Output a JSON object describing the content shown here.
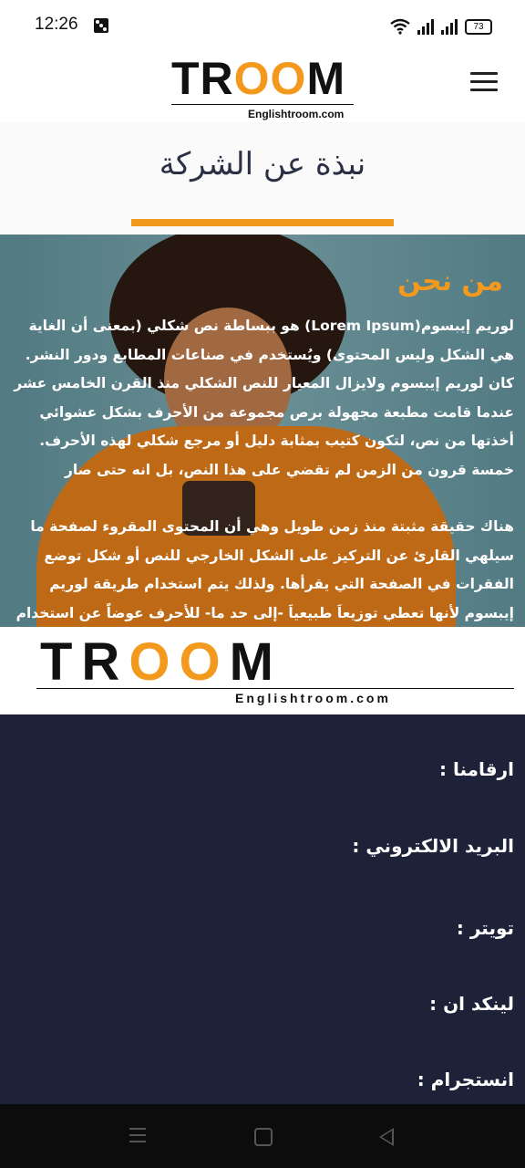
{
  "status_bar": {
    "time": "12:26",
    "battery": "73"
  },
  "header": {
    "logo_text_left": "TR",
    "logo_text_oo": "OO",
    "logo_text_right": "M",
    "logo_subtitle": "Englishtroom.com",
    "menu_icon": "hamburger-icon"
  },
  "page": {
    "title": "نبذة عن الشركة"
  },
  "hero": {
    "heading": "من نحن",
    "paragraph1": "لوريم إيبسوم(Lorem Ipsum) هو ببساطة نص شكلي (بمعنى أن الغاية هي الشكل وليس المحتوى) ويُستخدم في صناعات المطابع ودور النشر. كان لوريم إيبسوم ولايزال المعيار للنص الشكلي منذ القرن الخامس عشر عندما قامت مطبعة مجهولة برص مجموعة من الأحرف بشكل عشوائي أخذتها من نص، لتكون كتيب بمثابة دليل أو مرجع شكلي لهذه الأحرف. خمسة قرون من الزمن لم تقضي على هذا النص، بل انه حتى صار مستخدماً وبشكله الأصلي في الطباعة والتنضيد الالكتروني. انتشر بشكل",
    "paragraph2": "هناك حقيقة مثبتة منذ زمن طويل وهي أن المحتوى المقروء لصفحة ما سيلهي القارئ عن التركيز على الشكل الخارجي للنص أو شكل توضع الفقرات في الصفحة التي يقرأها. ولذلك يتم استخدام طريقة لوريم إيبسوم لأنها تعطي توزيعاَ طبيعياَ -إلى حد ما- للأحرف عوضاً عن استخدام \"هنا يوجد محتوى نص، هنا يوجد محتوى نص\""
  },
  "footer_logo": {
    "text_left": "TR",
    "text_oo": "OO",
    "text_right": "M",
    "subtitle": "Englishtroom.com"
  },
  "footer": {
    "numbers": "ارقامنا :",
    "email": "البريد الالكتروني :",
    "twitter": "تويتر :",
    "linkedin": "لينكد ان :",
    "instagram": "انستجرام :"
  },
  "colors": {
    "accent": "#f39a1e",
    "footer_bg": "#1e2238"
  }
}
